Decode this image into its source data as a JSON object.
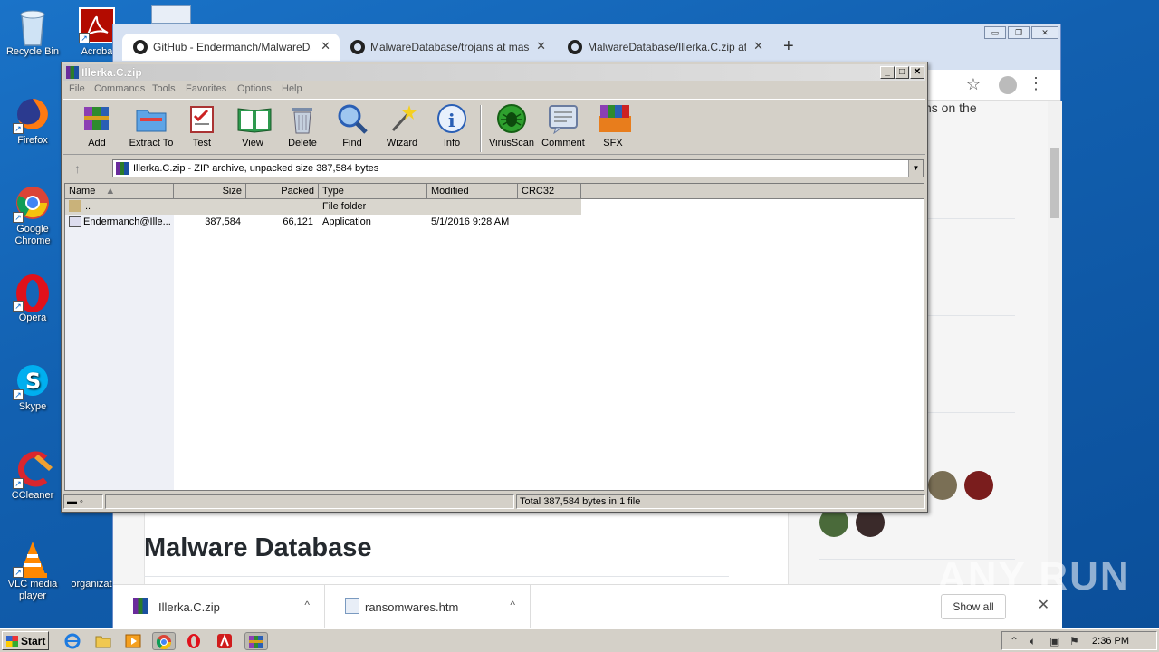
{
  "desktop": {
    "icons": [
      {
        "label": "Recycle Bin",
        "icon": "recycle-bin-icon"
      },
      {
        "label": "Acroba",
        "icon": "acrobat-icon"
      },
      {
        "label": "Firefox",
        "icon": "firefox-icon"
      },
      {
        "label": "Google Chrome",
        "icon": "chrome-icon"
      },
      {
        "label": "Opera",
        "icon": "opera-icon"
      },
      {
        "label": "Skype",
        "icon": "skype-icon"
      },
      {
        "label": "CCleaner",
        "icon": "ccleaner-icon"
      },
      {
        "label": "VLC media player",
        "icon": "vlc-icon"
      },
      {
        "label": "organizat",
        "icon": "document-icon"
      }
    ]
  },
  "chrome": {
    "tabs": [
      {
        "title": "GitHub - Endermanch/MalwareDatab",
        "active": true
      },
      {
        "title": "MalwareDatabase/trojans at master",
        "active": false
      },
      {
        "title": "MalwareDatabase/Illerka.C.zip at ma",
        "active": false
      }
    ],
    "new_tab_label": "+",
    "window_buttons": [
      "▭",
      "❐",
      "✕"
    ],
    "page": {
      "side_text": "ns on the",
      "heading": "Malware Database"
    },
    "downloads": {
      "items": [
        {
          "name": "Illerka.C.zip",
          "chevron": "^"
        },
        {
          "name": "ransomwares.htm",
          "chevron": "^"
        }
      ],
      "show_all": "Show all",
      "close": "✕"
    }
  },
  "winrar": {
    "title": "Illerka.C.zip",
    "window_buttons": [
      "_",
      "□",
      "✕"
    ],
    "menu": [
      "File",
      "Commands",
      "Tools",
      "Favorites",
      "Options",
      "Help"
    ],
    "toolbar": [
      {
        "label": "Add",
        "icon": "add-archive-icon"
      },
      {
        "label": "Extract To",
        "icon": "extract-folder-icon"
      },
      {
        "label": "Test",
        "icon": "test-clipboard-icon"
      },
      {
        "label": "View",
        "icon": "view-book-icon"
      },
      {
        "label": "Delete",
        "icon": "trash-icon"
      },
      {
        "label": "Find",
        "icon": "magnifier-icon"
      },
      {
        "label": "Wizard",
        "icon": "wand-icon"
      },
      {
        "label": "Info",
        "icon": "info-icon"
      },
      {
        "label": "VirusScan",
        "icon": "bug-icon"
      },
      {
        "label": "Comment",
        "icon": "comment-icon"
      },
      {
        "label": "SFX",
        "icon": "sfx-books-icon"
      }
    ],
    "path": "Illerka.C.zip - ZIP archive, unpacked size 387,584 bytes",
    "columns": [
      "Name",
      "Size",
      "Packed",
      "Type",
      "Modified",
      "CRC32"
    ],
    "rows": [
      {
        "name": "..",
        "size": "",
        "packed": "",
        "type": "File folder",
        "modified": ""
      },
      {
        "name": "Endermanch@Ille...",
        "size": "387,584",
        "packed": "66,121",
        "type": "Application",
        "modified": "5/1/2016 9:28 AM"
      }
    ],
    "status": "Total 387,584 bytes in 1 file"
  },
  "taskbar": {
    "start_label": "Start",
    "clock": "2:36 PM"
  },
  "watermark": "ANY RUN"
}
